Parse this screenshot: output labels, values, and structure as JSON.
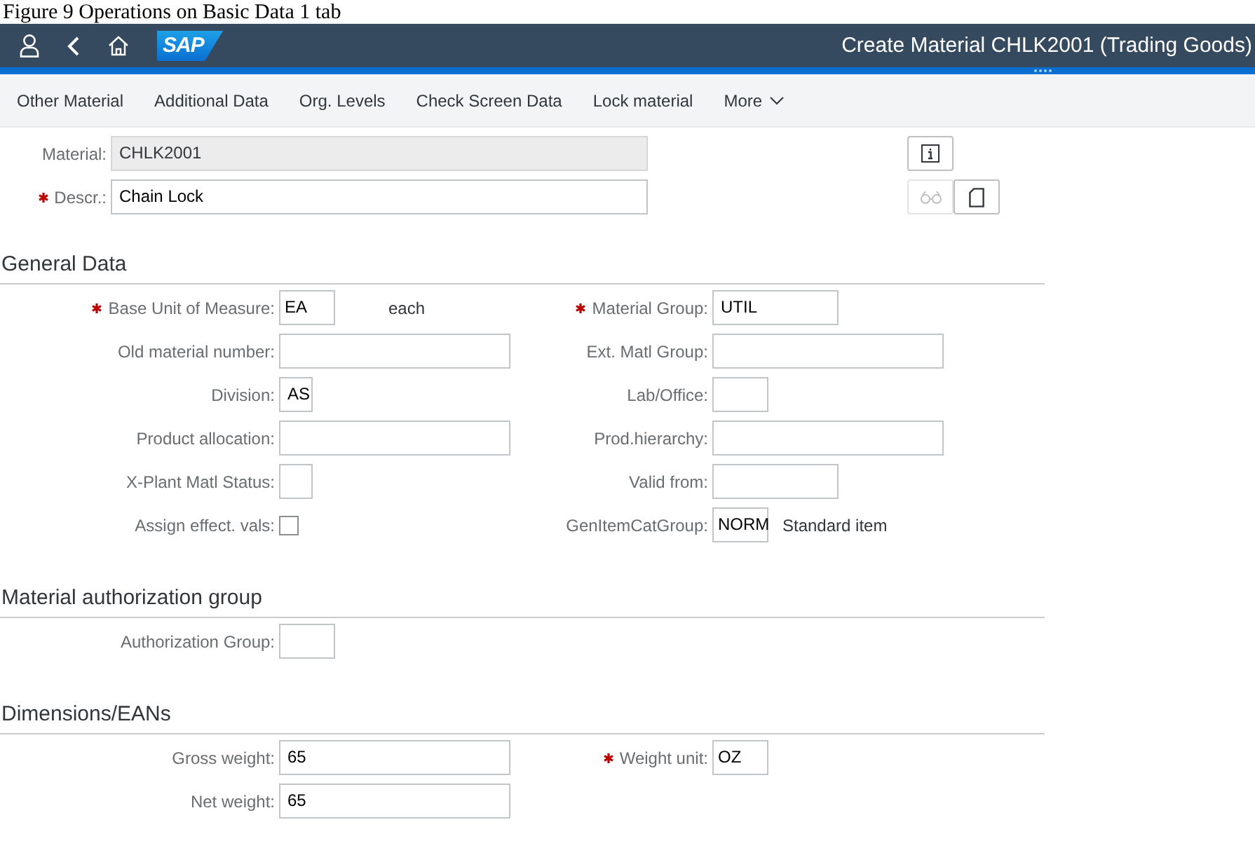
{
  "caption": "Figure 9 Operations on Basic Data 1 tab",
  "shell": {
    "logo": "SAP",
    "title": "Create Material CHLK2001 (Trading Goods)"
  },
  "toolbar": [
    {
      "label": "Other Material",
      "kind": "action"
    },
    {
      "label": "Additional Data",
      "kind": "action"
    },
    {
      "label": "Org. Levels",
      "kind": "action"
    },
    {
      "label": "Check Screen Data",
      "kind": "action"
    },
    {
      "label": "Lock material",
      "kind": "action"
    },
    {
      "label": "More",
      "kind": "menu"
    }
  ],
  "header": {
    "fields": [
      {
        "label": "Material:",
        "required": false,
        "value": "CHLK2001",
        "readonly": true
      },
      {
        "label": "Descr.:",
        "required": true,
        "value": "Chain Lock",
        "readonly": false
      }
    ],
    "buttons": [
      {
        "kind": "info",
        "disabled": false
      },
      {
        "kind": "glasses",
        "disabled": true
      },
      {
        "kind": "page",
        "disabled": false
      }
    ]
  },
  "sections": [
    {
      "title": "General Data",
      "rows": [
        {
          "fields": [
            {
              "label": "Base Unit of Measure:",
              "required": true,
              "kind": "short",
              "value": "EA",
              "suffix": "each"
            },
            {
              "label": "Material Group:",
              "required": true,
              "kind": "medium",
              "value": "UTIL"
            }
          ]
        },
        {
          "fields": [
            {
              "label": "Old material number:",
              "required": false,
              "kind": "long"
            },
            {
              "label": "Ext. Matl Group:",
              "required": false,
              "kind": "long"
            }
          ]
        },
        {
          "fields": [
            {
              "label": "Division:",
              "required": false,
              "kind": "tiny",
              "value": "AS"
            },
            {
              "label": "Lab/Office:",
              "required": false,
              "kind": "short"
            }
          ]
        },
        {
          "fields": [
            {
              "label": "Product allocation:",
              "required": false,
              "kind": "long"
            },
            {
              "label": "Prod.hierarchy:",
              "required": false,
              "kind": "long"
            }
          ]
        },
        {
          "fields": [
            {
              "label": "X-Plant Matl Status:",
              "required": false,
              "kind": "tiny"
            },
            {
              "label": "Valid from:",
              "required": false,
              "kind": "medium"
            }
          ]
        },
        {
          "fields": [
            {
              "label": "Assign effect. vals:",
              "required": false,
              "kind": "checkbox",
              "checked": false
            },
            {
              "label": "GenItemCatGroup:",
              "required": false,
              "kind": "short",
              "value": "NORM",
              "suffix": "Standard item"
            }
          ]
        }
      ]
    },
    {
      "title": "Material authorization group",
      "rows": [
        {
          "fields": [
            {
              "label": "Authorization Group:",
              "required": false,
              "kind": "short"
            }
          ]
        }
      ]
    },
    {
      "title": "Dimensions/EANs",
      "rows": [
        {
          "fields": [
            {
              "label": "Gross weight:",
              "required": false,
              "kind": "long",
              "value": "65"
            },
            {
              "label": "Weight unit:",
              "required": true,
              "kind": "short",
              "value": "OZ"
            }
          ]
        },
        {
          "fields": [
            {
              "label": "Net weight:",
              "required": false,
              "kind": "long",
              "value": "65"
            }
          ]
        }
      ]
    }
  ]
}
